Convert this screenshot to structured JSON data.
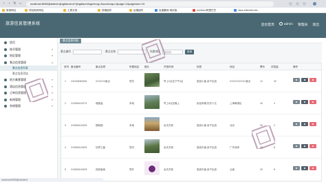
{
  "browser": {
    "tab_title": "首页",
    "address": "localhost:8080/jkiadmin/jingdianxinxi?jingdianmingcheng=&suoshuqu=&page=1&pagesize=10",
    "bookmarks": [
      "常用网址",
      "项目相关网址",
      "工具文档",
      "前端组件",
      "后端组件",
      "百度翻译-网页版",
      "iconfont-阿里巴巴",
      "Java Interview Ad..."
    ]
  },
  "header": {
    "title": "旅游信息管理系统",
    "links": [
      "后台首页",
      "admin",
      "管理员",
      "退出"
    ]
  },
  "sidebar": {
    "items": [
      {
        "label": "首页"
      },
      {
        "label": "账号管理"
      },
      {
        "label": "地区管理"
      },
      {
        "label": "景点信息管理"
      },
      {
        "label": "景点信息列表"
      },
      {
        "label": "景点信息添加"
      },
      {
        "label": "地方美食管理"
      },
      {
        "label": "酒店信息管理"
      },
      {
        "label": "订单信息管理"
      },
      {
        "label": "新闻管理"
      },
      {
        "label": "系统管理"
      }
    ]
  },
  "breadcrumb": {
    "label": "景点信息列表"
  },
  "search": {
    "label_name": "景点编号",
    "label_title": "景点名称",
    "label_area": "所属地区",
    "placeholder_name": "",
    "placeholder_title": "",
    "area_value": "请选择",
    "button": "查询"
  },
  "table": {
    "headers": [
      "序号",
      "景点编号",
      "景点名称",
      "所属地区",
      "图片",
      "开放时间",
      "标签",
      "地址",
      "票价",
      "浏览量",
      "操作"
    ],
    "rows": [
      {
        "index": "1",
        "code": "242346082345",
        "name": "XXXXXX景点",
        "area": "境内",
        "hours": "早上9点至下午5点",
        "tags": "旅游小景,亲子出游",
        "address": "XXXXXXXXXX景点",
        "price": "12",
        "views": "32"
      },
      {
        "index": "2",
        "code": "210506140274",
        "name": "城隍庙",
        "area": "本地",
        "hours": "早上8点至晚上",
        "tags": "民俗风情,历史人文",
        "address": "上海黄浦区",
        "price": "40",
        "views": "4"
      },
      {
        "index": "3",
        "code": "210506140303",
        "name": "颐和园",
        "area": "本地",
        "hours": "全天开放",
        "tags": "旅游小景,亲子出游",
        "address": "北京",
        "price": "30",
        "views": "2"
      },
      {
        "index": "4",
        "code": "210506140303",
        "name": "世界之窗",
        "area": "境内",
        "hours": "全天开放",
        "tags": "旅游中景,亲子出游",
        "address": "广东深圳",
        "price": "20",
        "views": "8"
      },
      {
        "index": "5",
        "code": "210506140303",
        "name": "西双版纳",
        "area": "境外",
        "hours": "全天开放",
        "tags": "旅游中景,亲子出游",
        "address": "云南",
        "price": "20",
        "views": "8"
      }
    ]
  },
  "status": {
    "text": "localhost:8080/jkiadmin/#"
  },
  "colors": {
    "header": "#4a6873",
    "delete": "#e76b76"
  }
}
